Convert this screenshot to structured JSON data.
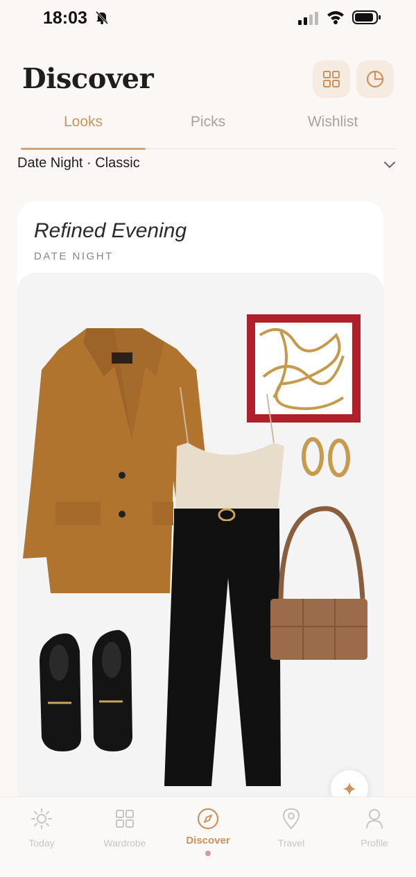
{
  "status_bar": {
    "time": "18:03"
  },
  "header": {
    "title": "Discover",
    "grid_icon": "grid-icon",
    "chart_icon": "pie-chart-icon"
  },
  "tabs": [
    {
      "label": "Looks",
      "active": true
    },
    {
      "label": "Picks",
      "active": false
    },
    {
      "label": "Wishlist",
      "active": false
    }
  ],
  "filter": {
    "value": "Date Night · Classic"
  },
  "look": {
    "title": "Refined Evening",
    "occasion": "DATE NIGHT",
    "items": [
      "camel blazer",
      "champagne camisole",
      "black trousers",
      "black loafers",
      "brown shoulder bag",
      "gold hoop earrings",
      "framed abstract art"
    ]
  },
  "nav": [
    {
      "label": "Today",
      "icon": "sun-icon",
      "active": false
    },
    {
      "label": "Wardrobe",
      "icon": "grid-icon",
      "active": false
    },
    {
      "label": "Discover",
      "icon": "compass-icon",
      "active": true
    },
    {
      "label": "Travel",
      "icon": "location-pin-icon",
      "active": false
    },
    {
      "label": "Profile",
      "icon": "person-icon",
      "active": false
    }
  ],
  "colors": {
    "accent": "#c9925e",
    "background": "#faf7f4",
    "card": "#ffffff"
  }
}
